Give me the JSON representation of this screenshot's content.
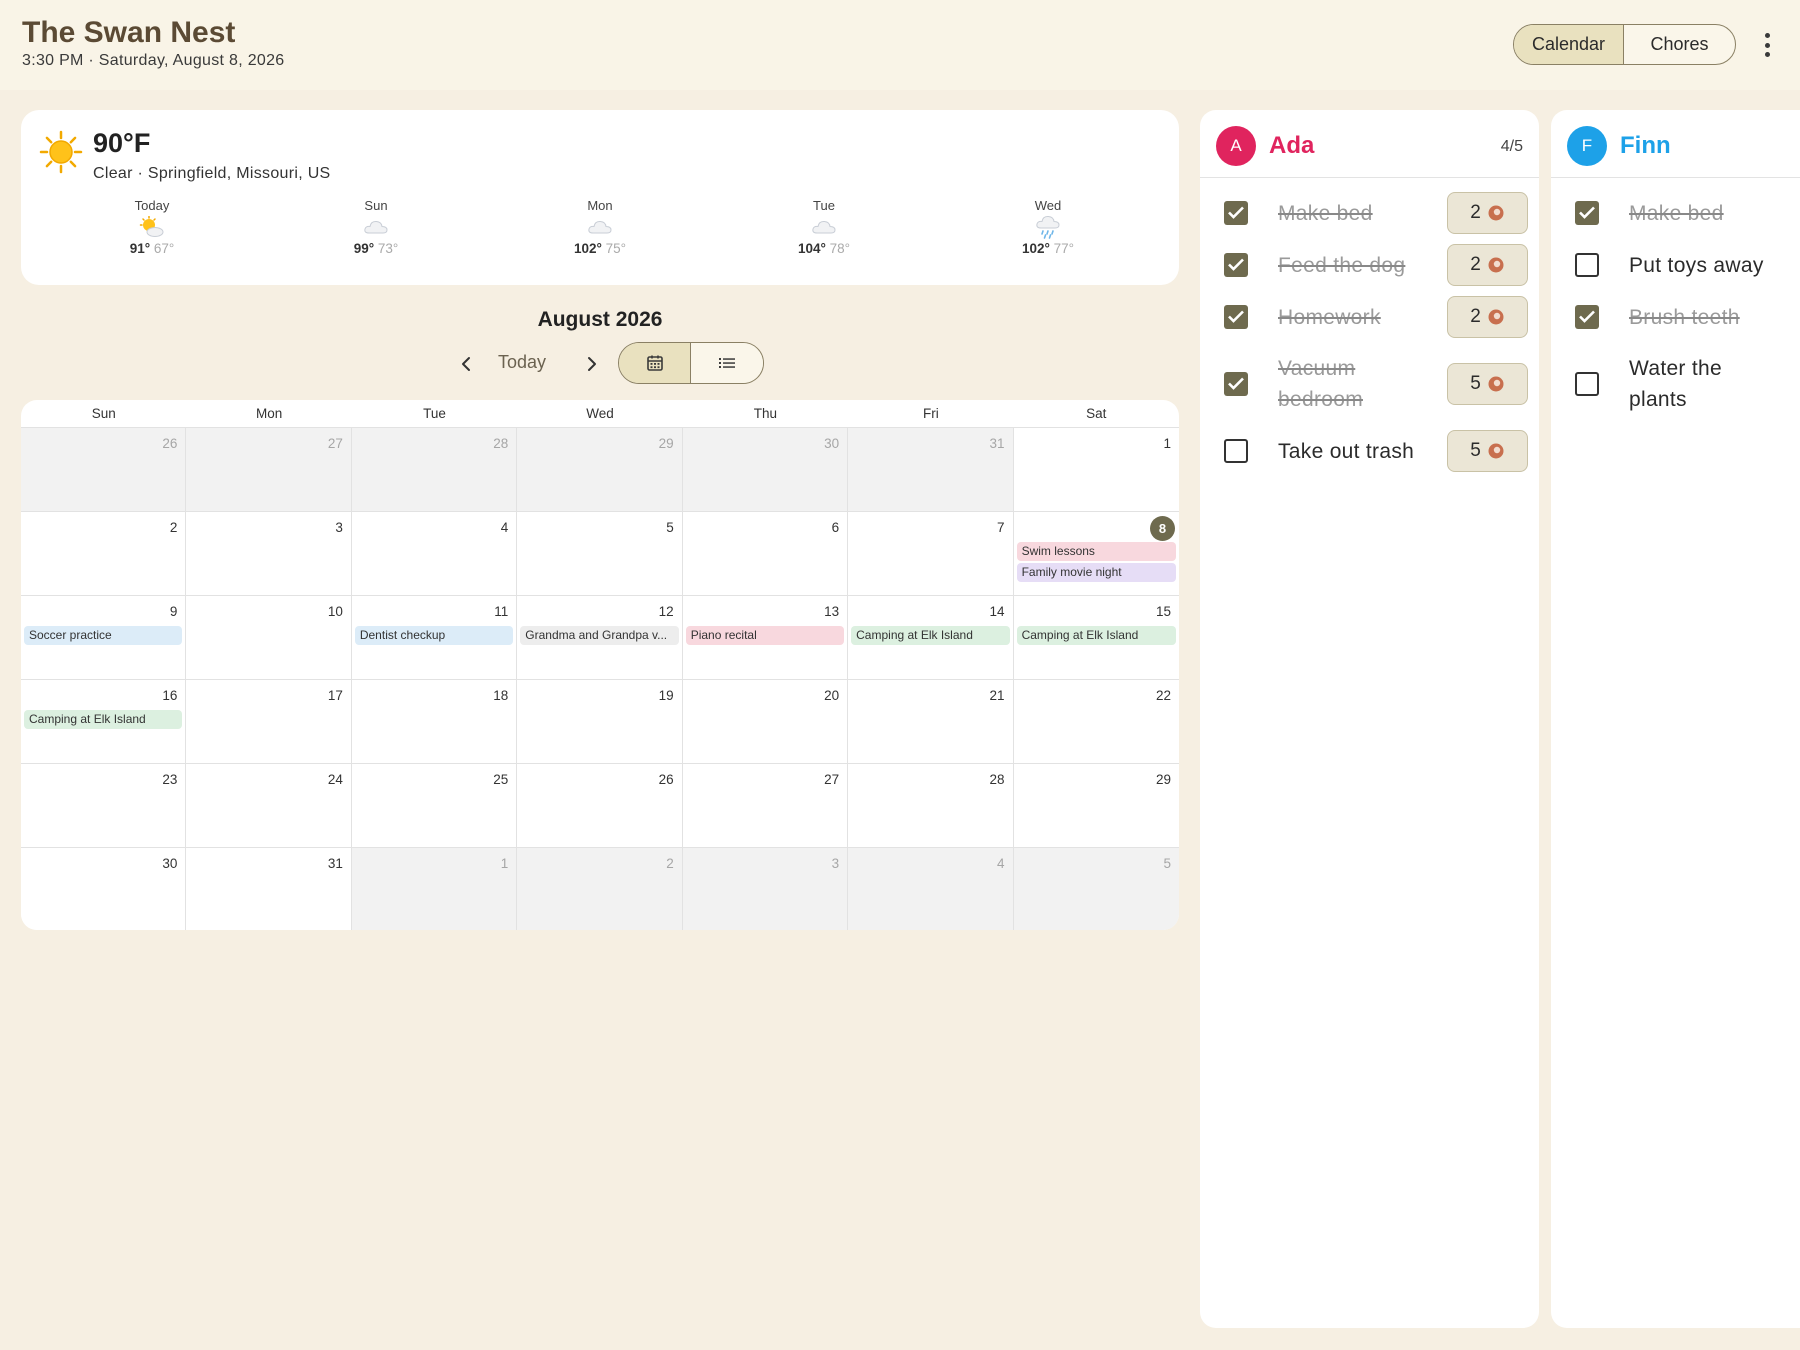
{
  "header": {
    "title": "The Swan Nest",
    "datetime": "3:30 PM · Saturday, August 8, 2026",
    "tabs": [
      {
        "label": "Calendar",
        "active": true
      },
      {
        "label": "Chores",
        "active": false
      }
    ],
    "menu_icon": "more-vertical-icon"
  },
  "weather": {
    "icon": "sun-icon",
    "temp": "90°F",
    "desc": "Clear · Springfield, Missouri, US",
    "forecast": [
      {
        "day": "Today",
        "icon": "partly-sunny-icon",
        "hi": "91°",
        "lo": "67°"
      },
      {
        "day": "Sun",
        "icon": "cloud-icon",
        "hi": "99°",
        "lo": "73°"
      },
      {
        "day": "Mon",
        "icon": "cloud-icon",
        "hi": "102°",
        "lo": "75°"
      },
      {
        "day": "Tue",
        "icon": "cloud-icon",
        "hi": "104°",
        "lo": "78°"
      },
      {
        "day": "Wed",
        "icon": "rain-cloud-icon",
        "hi": "102°",
        "lo": "77°"
      }
    ]
  },
  "calendar": {
    "title": "August 2026",
    "today_label": "Today",
    "weekdays": [
      "Sun",
      "Mon",
      "Tue",
      "Wed",
      "Thu",
      "Fri",
      "Sat"
    ],
    "colors": {
      "blue": "#dcecf8",
      "pink": "#f8d8de",
      "purple": "#e6ddf6",
      "green": "#dcf0e0",
      "grey": "#ededed",
      "today": "#6e6a4e"
    },
    "days": [
      {
        "n": "26",
        "other": true
      },
      {
        "n": "27",
        "other": true
      },
      {
        "n": "28",
        "other": true
      },
      {
        "n": "29",
        "other": true
      },
      {
        "n": "30",
        "other": true
      },
      {
        "n": "31",
        "other": true
      },
      {
        "n": "1"
      },
      {
        "n": "2"
      },
      {
        "n": "3"
      },
      {
        "n": "4"
      },
      {
        "n": "5"
      },
      {
        "n": "6"
      },
      {
        "n": "7"
      },
      {
        "n": "8",
        "today": true,
        "events": [
          {
            "title": "Swim lessons",
            "color": "pink"
          },
          {
            "title": "Family movie night",
            "color": "purple"
          }
        ]
      },
      {
        "n": "9",
        "events": [
          {
            "title": "Soccer practice",
            "color": "blue"
          }
        ]
      },
      {
        "n": "10"
      },
      {
        "n": "11",
        "events": [
          {
            "title": "Dentist checkup",
            "color": "blue"
          }
        ]
      },
      {
        "n": "12",
        "events": [
          {
            "title": "Grandma and Grandpa v...",
            "color": "grey"
          }
        ]
      },
      {
        "n": "13",
        "events": [
          {
            "title": "Piano recital",
            "color": "pink"
          }
        ]
      },
      {
        "n": "14",
        "events": [
          {
            "title": "Camping at Elk Island",
            "color": "green"
          }
        ]
      },
      {
        "n": "15",
        "events": [
          {
            "title": "Camping at Elk Island",
            "color": "green"
          }
        ]
      },
      {
        "n": "16",
        "events": [
          {
            "title": "Camping at Elk Island",
            "color": "green"
          }
        ]
      },
      {
        "n": "17"
      },
      {
        "n": "18"
      },
      {
        "n": "19"
      },
      {
        "n": "20"
      },
      {
        "n": "21"
      },
      {
        "n": "22"
      },
      {
        "n": "23"
      },
      {
        "n": "24"
      },
      {
        "n": "25"
      },
      {
        "n": "26"
      },
      {
        "n": "27"
      },
      {
        "n": "28"
      },
      {
        "n": "29"
      },
      {
        "n": "30"
      },
      {
        "n": "31"
      },
      {
        "n": "1",
        "other": true
      },
      {
        "n": "2",
        "other": true
      },
      {
        "n": "3",
        "other": true
      },
      {
        "n": "4",
        "other": true
      },
      {
        "n": "5",
        "other": true
      }
    ]
  },
  "members": [
    {
      "initial": "A",
      "name": "Ada",
      "color": "#e0245e",
      "progress": "4/5",
      "chores": [
        {
          "label": "Make bed",
          "done": true,
          "points": "2"
        },
        {
          "label": "Feed the dog",
          "done": true,
          "points": "2"
        },
        {
          "label": "Homework",
          "done": true,
          "points": "2"
        },
        {
          "label": "Vacuum bedroom",
          "done": true,
          "points": "5"
        },
        {
          "label": "Take out trash",
          "done": false,
          "points": "5"
        }
      ]
    },
    {
      "initial": "F",
      "name": "Finn",
      "color": "#1da1e8",
      "chores": [
        {
          "label": "Make bed",
          "done": true
        },
        {
          "label": "Put toys away",
          "done": false
        },
        {
          "label": "Brush teeth",
          "done": true
        },
        {
          "label": "Water the plants",
          "done": false
        }
      ]
    }
  ]
}
